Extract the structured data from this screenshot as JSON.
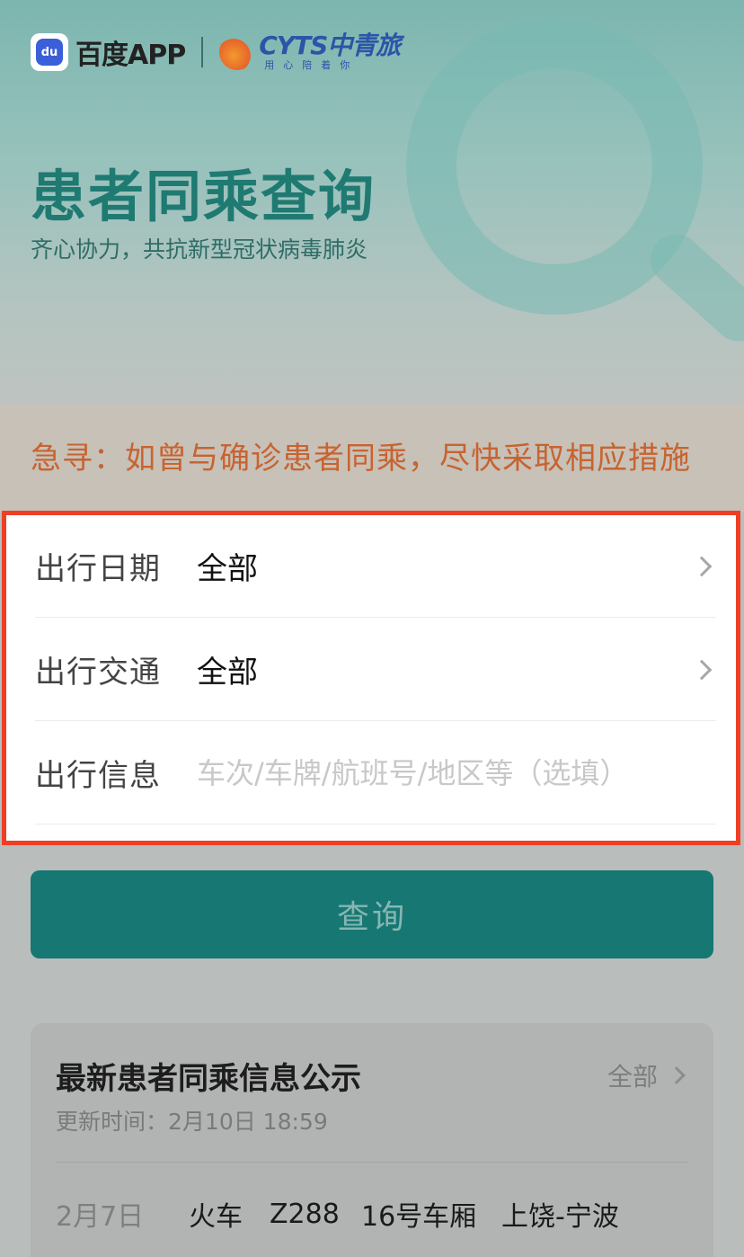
{
  "header": {
    "baidu_logo_glyph": "du",
    "baidu_brand": "百度APP",
    "partner_brand": "CYTS中青旅",
    "partner_slogan": "用心陪着你",
    "title": "患者同乘查询",
    "subtitle": "齐心协力，共抗新型冠状病毒肺炎"
  },
  "alert": {
    "text": "急寻：如曾与确诊患者同乘，尽快采取相应措施"
  },
  "form": {
    "date": {
      "label": "出行日期",
      "value": "全部"
    },
    "transport": {
      "label": "出行交通",
      "value": "全部"
    },
    "info": {
      "label": "出行信息",
      "placeholder": "车次/车牌/航班号/地区等（选填）",
      "value": ""
    }
  },
  "query_button": {
    "label": "查询"
  },
  "latest": {
    "title": "最新患者同乘信息公示",
    "more_label": "全部",
    "updated_label": "更新时间：",
    "updated_time": "2月10日 18:59",
    "records": [
      {
        "date": "2月7日",
        "mode": "火车",
        "number": "Z288",
        "car": "16号车厢",
        "route": "上饶-宁波"
      }
    ]
  },
  "colors": {
    "brand_teal": "#1f7a72",
    "alert_orange": "#c86330",
    "highlight_border": "#ee3f24",
    "button_bg": "#177773"
  }
}
